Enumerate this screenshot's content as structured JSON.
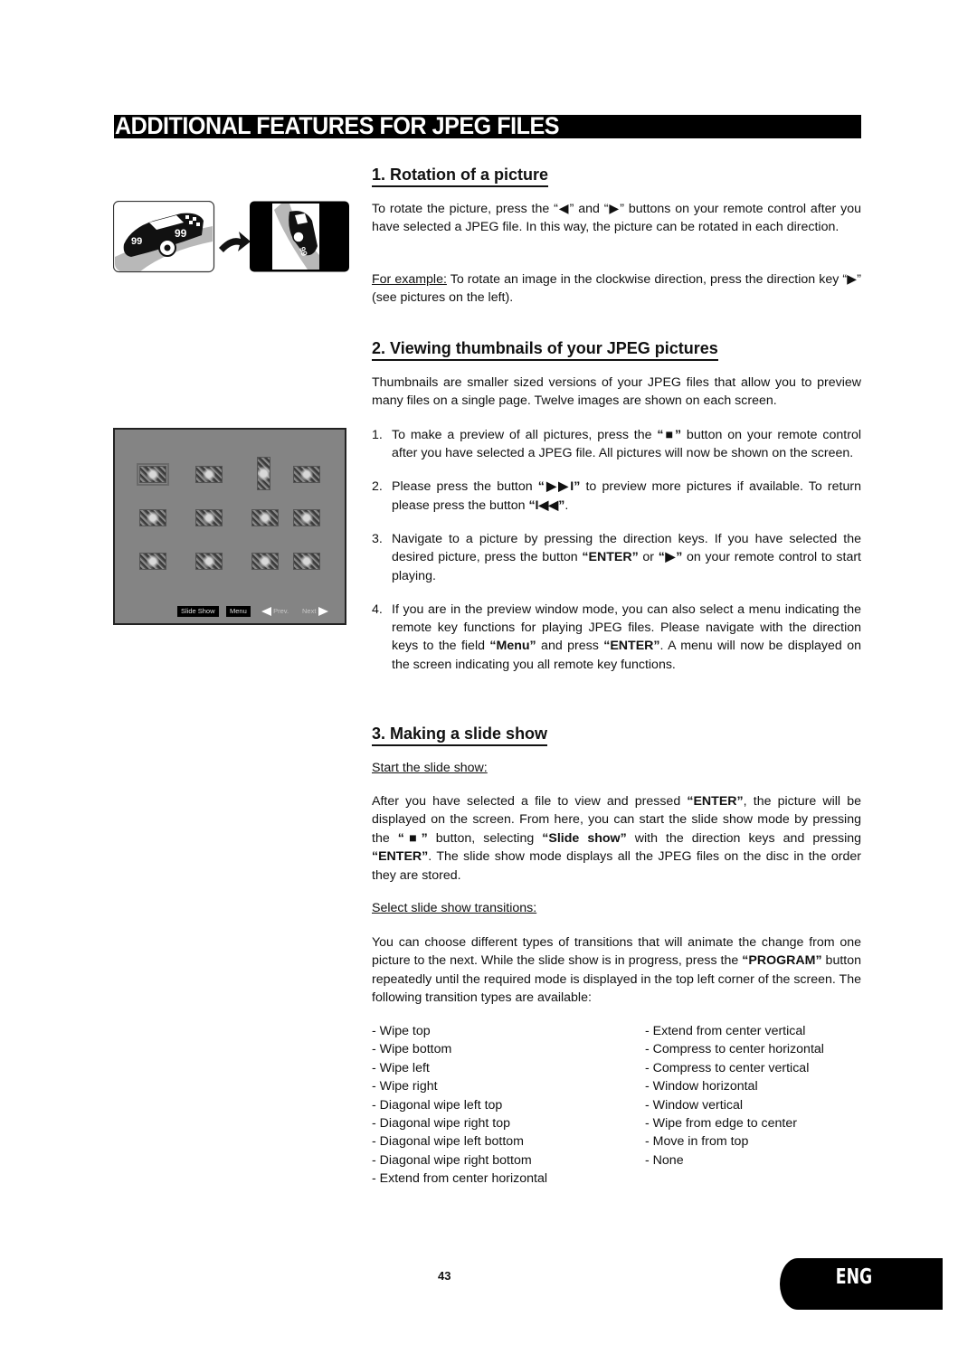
{
  "page": {
    "title": "ADDITIONAL FEATURES FOR JPEG FILES",
    "page_number": "43",
    "language_tab": "ENG"
  },
  "section1": {
    "heading": "1. Rotation of a picture",
    "para1": "To rotate the picture, press the “◀” and “▶” buttons on your remote control after you have selected a JPEG file. In this way, the picture can be rotated in each direction.",
    "example_label": "For example:",
    "example_text": " To rotate an image in the clockwise direction, press the direction key “▶” (see pictures on the left).",
    "figure": {
      "car_number": "99",
      "arrow_icon": "curved-arrow-right"
    }
  },
  "section2": {
    "heading": "2. Viewing thumbnails of your JPEG pictures",
    "intro": "Thumbnails are smaller sized versions of your JPEG files that allow you to preview many files on a single page. Twelve images are shown on each screen.",
    "steps": [
      {
        "num": "1.",
        "parts": [
          {
            "t": "To make a preview of all pictures, press the "
          },
          {
            "t": "“■”",
            "b": true
          },
          {
            "t": " button on your remote control after you have selected a JPEG file. All pictures will now be shown on the screen."
          }
        ]
      },
      {
        "num": "2.",
        "parts": [
          {
            "t": "Please press the button "
          },
          {
            "t": "“▶▶I”",
            "b": true
          },
          {
            "t": " to preview more pictures if available. To return please press the button "
          },
          {
            "t": "“I◀◀”",
            "b": true
          },
          {
            "t": "."
          }
        ]
      },
      {
        "num": "3.",
        "parts": [
          {
            "t": "Navigate to a picture by pressing the direction keys. If you have selected the desired picture, press the button "
          },
          {
            "t": "“ENTER”",
            "b": true
          },
          {
            "t": " or "
          },
          {
            "t": "“▶”",
            "b": true
          },
          {
            "t": " on your remote control to start playing."
          }
        ]
      },
      {
        "num": "4.",
        "parts": [
          {
            "t": "If you are in the preview  window  mode, you can also select a menu indicating the remote key functions for playing JPEG files. Please navigate with the direction keys to the field "
          },
          {
            "t": "“Menu”",
            "b": true
          },
          {
            "t": " and press "
          },
          {
            "t": "“ENTER”",
            "b": true
          },
          {
            "t": ".  A menu will now be displayed on the screen indicating you all remote key functions."
          }
        ]
      }
    ],
    "screen": {
      "thumbnail_count": 12,
      "selected_index": 0,
      "buttons": {
        "slide_show": "Slide Show",
        "menu": "Menu",
        "prev": "Prev.",
        "next": "Next"
      }
    }
  },
  "section3": {
    "heading": "3. Making a slide show",
    "sub1": "Start the slide show:",
    "para1_parts": [
      {
        "t": "After you have selected a file to view and pressed "
      },
      {
        "t": "“ENTER”",
        "b": true
      },
      {
        "t": ", the picture will be displayed on the screen. From here, you can start the slide show mode by pressing the "
      },
      {
        "t": "“■”",
        "b": true
      },
      {
        "t": " button, selecting "
      },
      {
        "t": "“Slide show”",
        "b": true
      },
      {
        "t": " with the direction keys and pressing "
      },
      {
        "t": "“ENTER”",
        "b": true
      },
      {
        "t": ". The slide show mode displays all the JPEG files on the disc in the order they are stored."
      }
    ],
    "sub2": "Select slide show transitions:",
    "para2_parts": [
      {
        "t": "You can choose different types of transitions that will animate the change from one picture to the next. While the slide show is in progress, press the "
      },
      {
        "t": "“PROGRAM”",
        "b": true
      },
      {
        "t": " button repeatedly until the required mode is displayed in the top left corner of the screen. The following transition types are available:"
      }
    ],
    "transitions_left": [
      "Wipe top",
      "Wipe bottom",
      "Wipe left",
      "Wipe right",
      "Diagonal wipe left top",
      "Diagonal wipe right top",
      "Diagonal wipe left bottom",
      "Diagonal wipe right bottom",
      "Extend from center horizontal"
    ],
    "transitions_right": [
      "Extend from center vertical",
      "Compress to center horizontal",
      "Compress to center vertical",
      "Window horizontal",
      "Window vertical",
      "Wipe from edge to center",
      "Move in from top",
      "None"
    ]
  }
}
